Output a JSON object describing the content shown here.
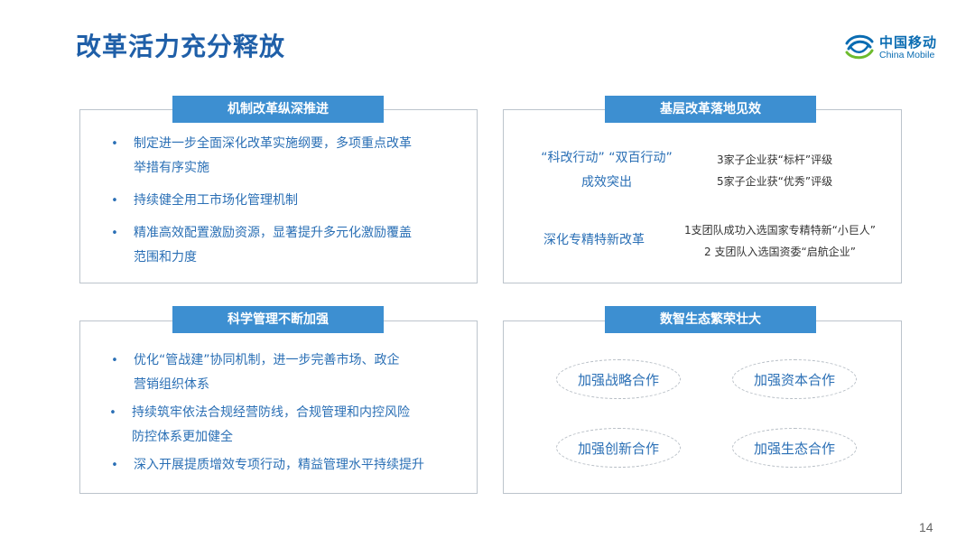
{
  "page": {
    "title": "改革活力充分释放",
    "number": "14"
  },
  "logo": {
    "cn": "中国移动",
    "en": "China Mobile",
    "icon": "china-mobile-logo-icon",
    "colors": [
      "#0a6cb2",
      "#6dbb2d"
    ]
  },
  "colors": {
    "title": "#1f5fa8",
    "header_bg": "#3d8fd1",
    "accent_text": "#2a6fb5",
    "panel_border": "#bcc4cc"
  },
  "panels": {
    "mechanism": {
      "header": "机制改革纵深推进",
      "bullets": [
        {
          "line1": "制定进一步全面深化改革实施纲要，多项重点改革",
          "line2": "举措有序实施"
        },
        {
          "line1": "持续健全用工市场化管理机制",
          "line2": ""
        },
        {
          "line1": "精准高效配置激励资源，显著提升多元化激励覆盖",
          "line2": "范围和力度"
        }
      ]
    },
    "grassroots": {
      "header": "基层改革落地见效",
      "left1_line1": "“科改行动” “双百行动”",
      "left1_line2": "成效突出",
      "right1_line1": "3家子企业获“标杆”评级",
      "right1_line2": "5家子企业获“优秀”评级",
      "left2": "深化专精特新改革",
      "right2_line1": "1支团队成功入选国家专精特新“小巨人”",
      "right2_line2": "2 支团队入选国资委“启航企业”"
    },
    "management": {
      "header": "科学管理不断加强",
      "bullets": [
        {
          "line1": "优化“管战建”协同机制，进一步完善市场、政企",
          "line2": "营销组织体系"
        },
        {
          "line1": "持续筑牢依法合规经营防线，合规管理和内控风险",
          "line2": "防控体系更加健全"
        },
        {
          "line1": "深入开展提质增效专项行动，精益管理水平持续提升",
          "line2": ""
        }
      ]
    },
    "ecosystem": {
      "header": "数智生态繁荣壮大",
      "items": [
        "加强战略合作",
        "加强资本合作",
        "加强创新合作",
        "加强生态合作"
      ]
    }
  }
}
